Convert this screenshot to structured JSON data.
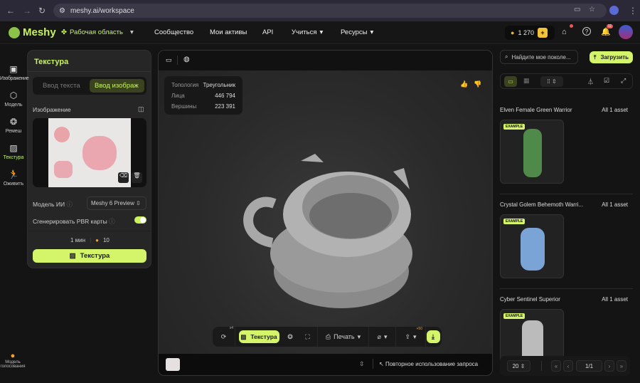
{
  "browser": {
    "url": "meshy.ai/workspace"
  },
  "header": {
    "logo": "Meshy",
    "workspace": "Рабочая область",
    "nav": [
      "Сообщество",
      "Мои активы",
      "API",
      "Учиться",
      "Ресурсы"
    ],
    "credits": "1 270",
    "notifications": "11"
  },
  "sidebar": {
    "items": [
      {
        "label": "Изображение"
      },
      {
        "label": "Модель"
      },
      {
        "label": "Ремеш"
      },
      {
        "label": "Текстура"
      },
      {
        "label": "Оживить"
      }
    ],
    "bottom": "Модель голосования"
  },
  "panel": {
    "title": "Текстура",
    "tab_text": "Ввод текста",
    "tab_image": "Ввод изображ",
    "image_label": "Изображение",
    "model_label": "Модель ИИ",
    "model_value": "Meshy 6 Preview",
    "pbr_label": "Сгенерировать PBR карты",
    "pbr_on": true,
    "time": "1 мин",
    "cost": "10",
    "submit": "Текстура"
  },
  "viewer": {
    "stats": {
      "topology_label": "Топология",
      "topology": "Треугольник",
      "faces_label": "Лица",
      "faces": "446 794",
      "verts_label": "Вершины",
      "verts": "223 391"
    },
    "toolbar": {
      "retry_badge": "x4",
      "texture": "Текстура",
      "print": "Печать",
      "export_badge": "+50"
    },
    "reuse": "Повторное использование запроса"
  },
  "right": {
    "search_placeholder": "Найдите мое поколе...",
    "upload": "Загрузить",
    "assets": [
      {
        "title": "Elven Female Green Warrior",
        "count": "All 1 asset",
        "badge": "EXAMPLE",
        "color": "#4f8a4a"
      },
      {
        "title": "Crystal Golem Behemoth Warri...",
        "count": "All 1 asset",
        "badge": "EXAMPLE",
        "color": "#7aa3d6"
      },
      {
        "title": "Cyber Sentinel Superior",
        "count": "All 1 asset",
        "badge": "EXAMPLE",
        "color": "#bbbbbb"
      }
    ],
    "page_size": "20",
    "page": "1/1"
  }
}
